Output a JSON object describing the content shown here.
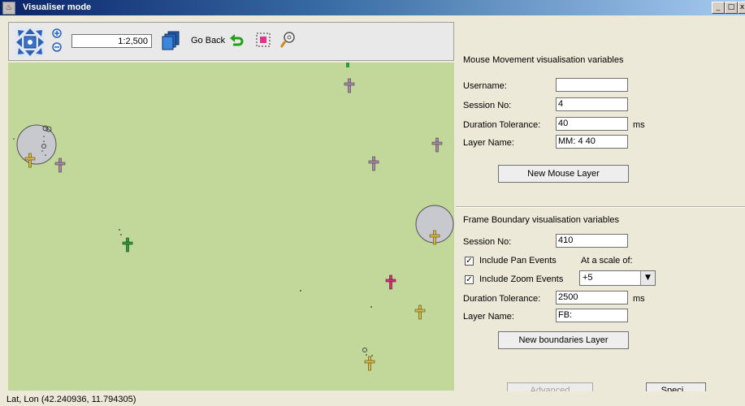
{
  "window": {
    "title": "Visualiser mode",
    "controls": {
      "minimize": "_",
      "maximize": "□",
      "close": "x"
    }
  },
  "toolbar": {
    "scale_value": "1:2,500",
    "go_back_label": "Go Back"
  },
  "status": {
    "coordinates": "Lat, Lon (42.240936, 11.794305)"
  },
  "mouse_section": {
    "title": "Mouse Movement visualisation variables",
    "username_label": "Username:",
    "username_value": "",
    "session_label": "Session No:",
    "session_value": "4",
    "duration_label": "Duration Tolerance:",
    "duration_value": "40",
    "duration_unit": "ms",
    "layer_label": "Layer Name:",
    "layer_value": "MM: 4 40",
    "new_layer_button": "New Mouse Layer"
  },
  "frame_section": {
    "title": "Frame Boundary visualisation variables",
    "session_label": "Session No:",
    "session_value": "410",
    "pan_label": "Include Pan Events",
    "pan_checked": true,
    "scale_label": "At a scale of:",
    "zoom_label": "Include Zoom Events",
    "zoom_checked": true,
    "scale_selected": "+5",
    "duration_label": "Duration Tolerance:",
    "duration_value": "2500",
    "duration_unit": "ms",
    "layer_label": "Layer Name:",
    "layer_value": "FB:",
    "new_layer_button": "New boundaries Layer"
  },
  "footer_buttons": {
    "advanced": "Advanced",
    "special": "Speci..."
  },
  "colors": {
    "map_background": "#c1d89a",
    "marker_purple": "#a98aa6",
    "marker_yellow": "#d7b94a",
    "marker_green": "#2f9a3a",
    "marker_pink": "#d4337a"
  }
}
